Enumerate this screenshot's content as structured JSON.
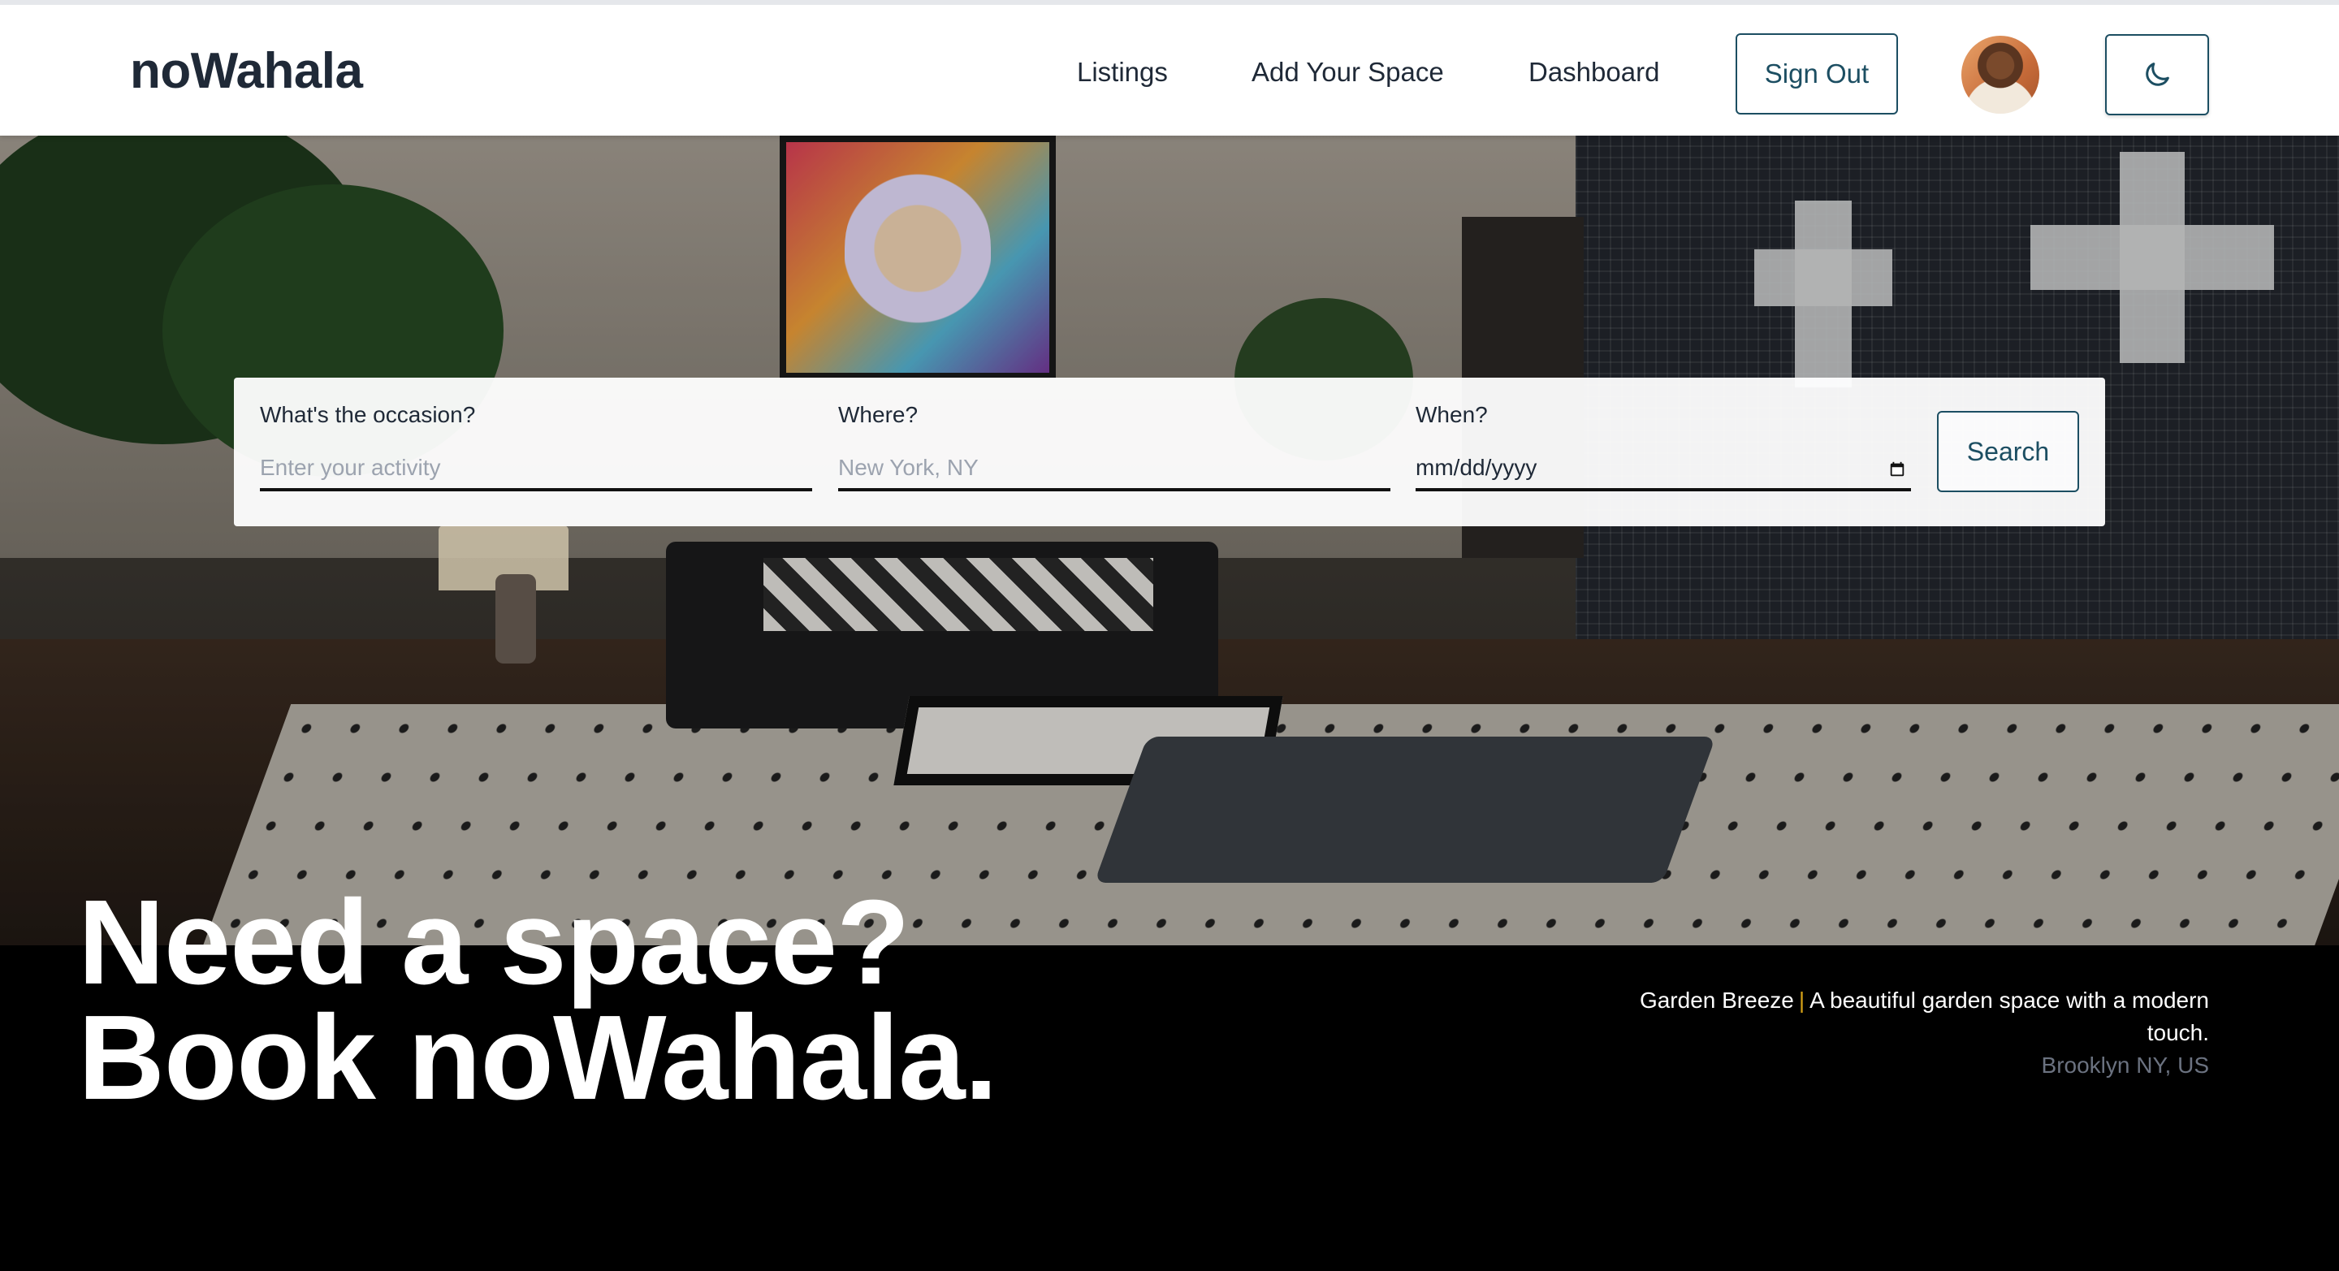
{
  "brand": "noWahala",
  "nav": {
    "listings": "Listings",
    "add_space": "Add Your Space",
    "dashboard": "Dashboard",
    "sign_out": "Sign Out"
  },
  "search": {
    "occasion_label": "What's the occasion?",
    "occasion_placeholder": "Enter your activity",
    "where_label": "Where?",
    "where_placeholder": "New York, NY",
    "when_label": "When?",
    "when_value": "mm/dd/yyyy",
    "button": "Search"
  },
  "hero": {
    "line1": "Need a space?",
    "line2": "Book noWahala."
  },
  "featured": {
    "name": "Garden Breeze",
    "separator": "|",
    "description": "A beautiful garden space with a modern touch.",
    "location": "Brooklyn NY, US"
  },
  "icons": {
    "theme_toggle": "moon-icon",
    "date_picker": "calendar-icon",
    "profile": "avatar"
  },
  "colors": {
    "accent": "#1c4e62",
    "separator": "#d4a017",
    "text_dark": "#1f2937"
  }
}
